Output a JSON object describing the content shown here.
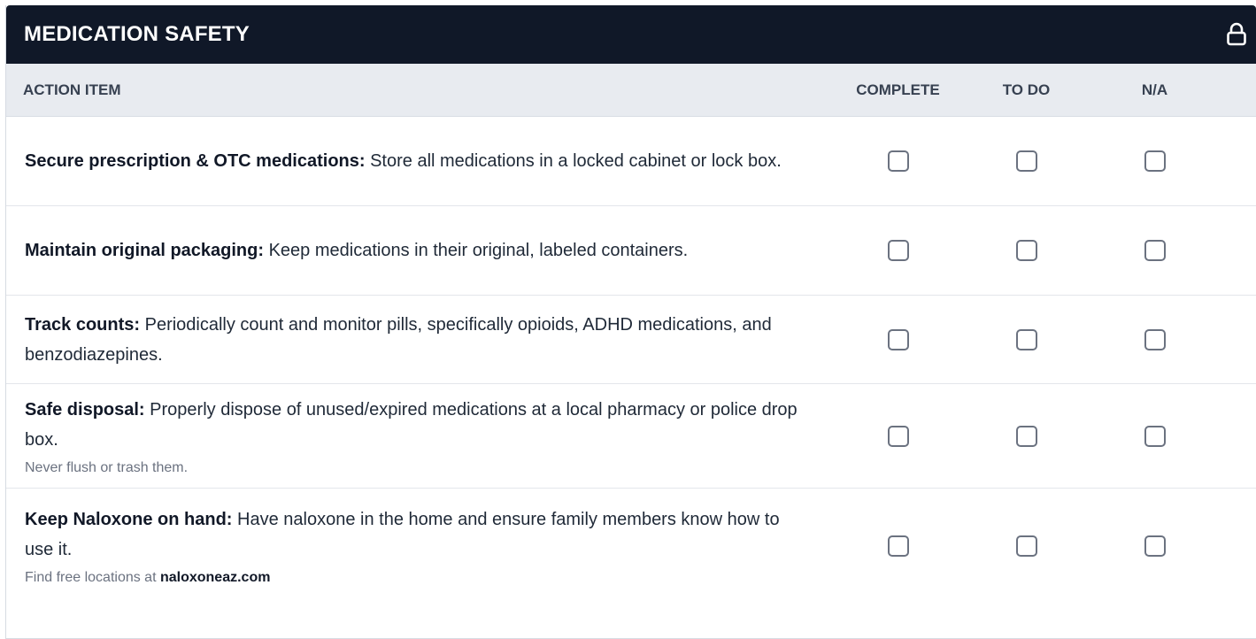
{
  "header": {
    "title": "MEDICATION SAFETY",
    "icon": "lock-icon"
  },
  "columns": {
    "action": "ACTION ITEM",
    "complete": "COMPLETE",
    "todo": "TO DO",
    "na": "N/A"
  },
  "items": [
    {
      "bold": "Secure prescription & OTC medications:",
      "text": " Store all medications in a locked cabinet or lock box.",
      "note": "",
      "note_link": ""
    },
    {
      "bold": "Maintain original packaging:",
      "text": " Keep medications in their original, labeled containers.",
      "note": "",
      "note_link": ""
    },
    {
      "bold": "Track counts:",
      "text": " Periodically count and monitor pills, specifically opioids, ADHD medications, and benzodiazepines.",
      "note": "",
      "note_link": ""
    },
    {
      "bold": "Safe disposal:",
      "text": " Properly dispose of unused/expired medications at a local pharmacy or police drop box.",
      "note": "Never flush or trash them.",
      "note_link": ""
    },
    {
      "bold": "Keep Naloxone on hand:",
      "text": " Have naloxone in the home and ensure family members know how to use it.",
      "note": "Find free locations at ",
      "note_link": "naloxoneaz.com"
    }
  ],
  "colors": {
    "header_bg": "#101828",
    "column_header_bg": "#e8ebf0",
    "checkbox_border": "#6b7280"
  }
}
